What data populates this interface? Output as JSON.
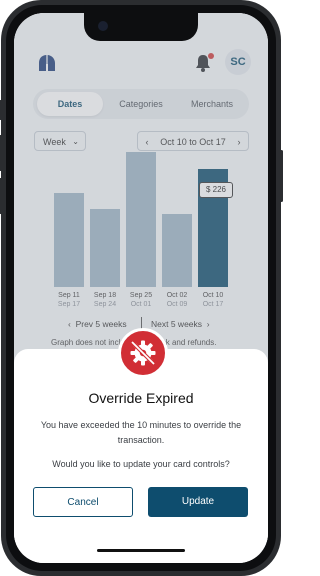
{
  "header": {
    "avatar_initials": "SC"
  },
  "tabs": [
    {
      "label": "Dates",
      "active": true
    },
    {
      "label": "Categories",
      "active": false
    },
    {
      "label": "Merchants",
      "active": false
    }
  ],
  "controls": {
    "period": "Week",
    "date_range": "Oct 10 to Oct 17"
  },
  "chart_data": {
    "type": "bar",
    "categories": [
      "Sep 11",
      "Sep 18",
      "Sep 25",
      "Oct 02",
      "Oct 10"
    ],
    "sub_labels": [
      "Sep 17",
      "Sep 24",
      "Oct 01",
      "Oct 09",
      "Oct 17"
    ],
    "values": [
      180,
      150,
      260,
      140,
      226
    ],
    "highlight_label": "$ 226",
    "selected_index": 4
  },
  "pager": {
    "prev_label": "Prev 5 weeks",
    "next_label": "Next 5 weeks"
  },
  "chart_note": "Graph does not include cashback and refunds.",
  "dialog": {
    "title": "Override Expired",
    "message": "You have exceeded the 10 minutes to override the transaction.",
    "question": "Would you like to update your card controls?",
    "cancel_label": "Cancel",
    "update_label": "Update",
    "icon": "gear-slash-icon"
  },
  "colors": {
    "brand": "#0e4d6e",
    "alert": "#d12e35",
    "bar": "#9fb5c6"
  }
}
